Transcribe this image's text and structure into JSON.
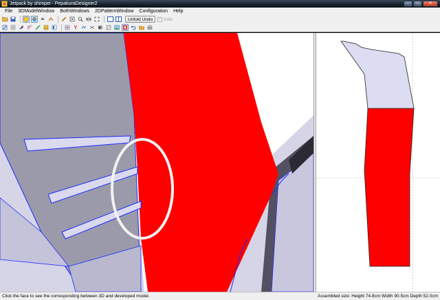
{
  "window": {
    "title": "Jetpack by shimpei - PepakuraDesigner2",
    "minimize_glyph": "–",
    "maximize_glyph": "□",
    "close_glyph": "✕"
  },
  "menu": {
    "items": [
      "File",
      "3DModelWindow",
      "BothWindows",
      "2DPatternWindow",
      "Configuration",
      "Help"
    ]
  },
  "toolbar": {
    "unfold_undo_label": "Unfold Undo",
    "auto_label": "Auto",
    "auto_checked": true,
    "row1_icons": [
      "open-folder",
      "save",
      "sep",
      "select-mode",
      "texture-mode",
      "sep",
      "move",
      "rotate",
      "sep",
      "pencil",
      "scale",
      "zoom",
      "flip",
      "fit",
      "sep",
      "single-view",
      "split-view"
    ],
    "row2_icons": [
      "arrange",
      "grid",
      "paint",
      "fold-line",
      "glue-flap",
      "cut",
      "sep",
      "select-face",
      "join",
      "split",
      "mountain",
      "valley",
      "print",
      "texture",
      "pressed-edit",
      "undo",
      "open",
      "print-preview"
    ]
  },
  "view3d": {
    "colors": {
      "red": "#ff0000",
      "gray": "#9b9aab",
      "light": "#d6d5e8",
      "edge": "#1a2bff",
      "dark": "#535161",
      "highlight": "#f2f2f2"
    }
  },
  "view2d": {
    "colors": {
      "red": "#ff0000",
      "light": "#dcdcf2",
      "outline": "#222222",
      "guide": "#a8a8a8"
    }
  },
  "status": {
    "left": "Click the face to see the corresponding between 3D and developed model.",
    "right": "Assembled size: Height 74.8cm Width 90.5cm Depth 52.0cm"
  }
}
